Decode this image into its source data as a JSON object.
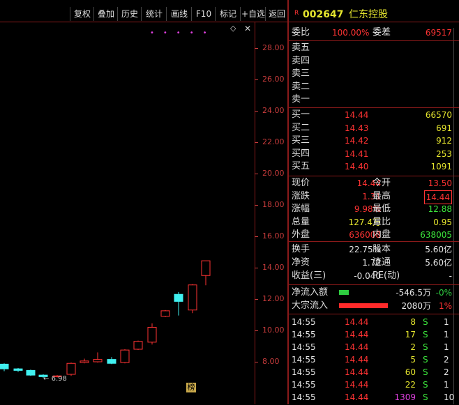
{
  "toolbar": [
    "复权",
    "叠加",
    "历史",
    "统计",
    "画线",
    "F10",
    "标记",
    "+自选",
    "返回"
  ],
  "stock": {
    "badge": "R",
    "code": "002647",
    "name": "仁东控股"
  },
  "order_ratio": {
    "label": "委比",
    "value": "100.00%",
    "label2": "委差",
    "value2": "69517"
  },
  "sell_levels": [
    "卖五",
    "卖四",
    "卖三",
    "卖二",
    "卖一"
  ],
  "buy_levels": [
    {
      "label": "买一",
      "price": "14.44",
      "vol": "66570"
    },
    {
      "label": "买二",
      "price": "14.43",
      "vol": "691"
    },
    {
      "label": "买三",
      "price": "14.42",
      "vol": "912"
    },
    {
      "label": "买四",
      "price": "14.41",
      "vol": "253"
    },
    {
      "label": "买五",
      "price": "14.40",
      "vol": "1091"
    }
  ],
  "quote": [
    {
      "l1": "现价",
      "v1": "14.44",
      "c1": "red",
      "l2": "今开",
      "v2": "13.50",
      "c2": "red"
    },
    {
      "l1": "涨跌",
      "v1": "1.31",
      "c1": "red",
      "l2": "最高",
      "v2": "14.44",
      "c2": "red"
    },
    {
      "l1": "涨幅",
      "v1": "9.98%",
      "c1": "red",
      "l2": "最低",
      "v2": "12.88",
      "c2": "green"
    },
    {
      "l1": "总量",
      "v1": "127.4万",
      "c1": "yellow",
      "l2": "量比",
      "v2": "0.95",
      "c2": "yellow"
    },
    {
      "l1": "外盘",
      "v1": "636008",
      "c1": "red",
      "l2": "内盘",
      "v2": "638005",
      "c2": "green"
    }
  ],
  "fundamentals": [
    {
      "l1": "换手",
      "v1": "22.75%",
      "l2": "股本",
      "v2": "5.60亿"
    },
    {
      "l1": "净资",
      "v1": "1.72",
      "l2": "流通",
      "v2": "5.60亿"
    },
    {
      "l1": "收益(三)",
      "v1": "-0.040",
      "l2": "PE(动)",
      "v2": "-"
    }
  ],
  "flows": [
    {
      "label": "净流入额",
      "value": "-546.5万",
      "pct": "-0%",
      "bar_color": "#2ecc40",
      "value_color": "#e6e6e6",
      "pct_color": "#2ecc40"
    },
    {
      "label": "大宗流入",
      "value": "2080万",
      "pct": "1%",
      "bar_color": "#ff2a2a",
      "value_color": "#e6e6e6",
      "pct_color": "#ff3333"
    }
  ],
  "ticks": [
    {
      "time": "14:55",
      "price": "14.44",
      "vol": "8",
      "side": "S",
      "n": "1",
      "vc": "yellow"
    },
    {
      "time": "14:55",
      "price": "14.44",
      "vol": "17",
      "side": "S",
      "n": "1",
      "vc": "yellow"
    },
    {
      "time": "14:55",
      "price": "14.44",
      "vol": "2",
      "side": "S",
      "n": "1",
      "vc": "yellow"
    },
    {
      "time": "14:55",
      "price": "14.44",
      "vol": "5",
      "side": "S",
      "n": "2",
      "vc": "yellow"
    },
    {
      "time": "14:55",
      "price": "14.44",
      "vol": "60",
      "side": "S",
      "n": "2",
      "vc": "yellow"
    },
    {
      "time": "14:55",
      "price": "14.44",
      "vol": "22",
      "side": "S",
      "n": "1",
      "vc": "yellow"
    },
    {
      "time": "14:55",
      "price": "14.44",
      "vol": "1309",
      "side": "S",
      "n": "10",
      "vc": "magenta"
    }
  ],
  "chart_data": {
    "type": "candlestick",
    "y_ticks": [
      "28.00",
      "26.00",
      "24.00",
      "22.00",
      "20.00",
      "18.00",
      "16.00",
      "14.00",
      "12.00",
      "10.00",
      "8.00"
    ],
    "ylim": [
      7.0,
      30.0
    ],
    "low_label": "6.98",
    "marker_label": "榜",
    "candles": [
      {
        "o": 7.85,
        "c": 7.55,
        "h": 7.9,
        "l": 7.4
      },
      {
        "o": 7.55,
        "c": 7.45,
        "h": 7.6,
        "l": 7.35
      },
      {
        "o": 7.45,
        "c": 7.15,
        "h": 7.5,
        "l": 7.1
      },
      {
        "o": 7.15,
        "c": 7.05,
        "h": 7.2,
        "l": 6.98
      },
      {
        "o": 7.05,
        "c": 7.1,
        "h": 7.15,
        "l": 7.0
      },
      {
        "o": 7.2,
        "c": 7.9,
        "h": 7.95,
        "l": 7.1
      },
      {
        "o": 7.95,
        "c": 8.05,
        "h": 8.2,
        "l": 7.9
      },
      {
        "o": 8.0,
        "c": 8.15,
        "h": 8.6,
        "l": 7.95
      },
      {
        "o": 8.15,
        "c": 7.9,
        "h": 8.3,
        "l": 7.85
      },
      {
        "o": 7.95,
        "c": 8.75,
        "h": 8.8,
        "l": 7.9
      },
      {
        "o": 8.8,
        "c": 9.3,
        "h": 9.35,
        "l": 8.75
      },
      {
        "o": 9.25,
        "c": 10.2,
        "h": 10.45,
        "l": 9.1
      },
      {
        "o": 10.9,
        "c": 11.25,
        "h": 11.3,
        "l": 10.85
      },
      {
        "o": 12.3,
        "c": 11.85,
        "h": 12.45,
        "l": 10.95
      },
      {
        "o": 11.3,
        "c": 12.9,
        "h": 12.95,
        "l": 11.1
      },
      {
        "o": 13.5,
        "c": 14.44,
        "h": 14.44,
        "l": 12.88
      }
    ]
  }
}
